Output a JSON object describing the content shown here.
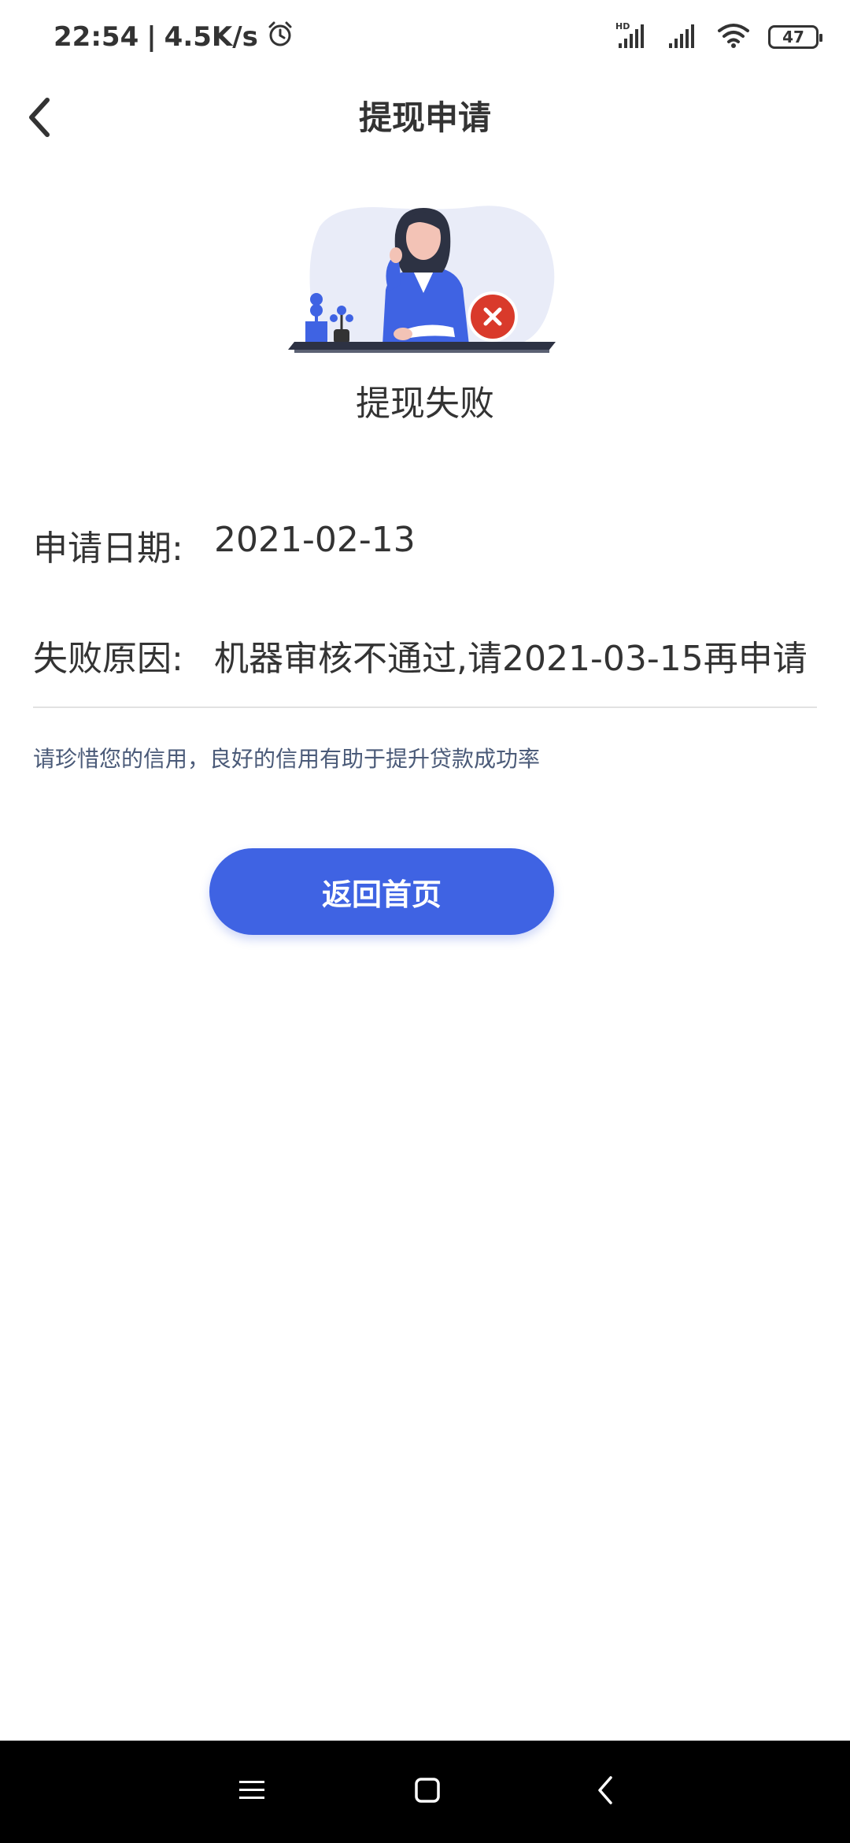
{
  "status_bar": {
    "time": "22:54",
    "separator": "|",
    "net_speed": "4.5K/s",
    "battery_level": "47",
    "icons": [
      "alarm-icon",
      "hd-signal-icon",
      "signal-icon",
      "wifi-icon",
      "battery-icon"
    ]
  },
  "header": {
    "title": "提现申请",
    "back_icon": "chevron-left-icon"
  },
  "result": {
    "illustration_icon": "woman-at-desk-illustration",
    "status_icon": "close-circle-icon",
    "title": "提现失败"
  },
  "info": {
    "date_label": "申请日期:",
    "date_value": "2021-02-13",
    "reason_label": "失败原因:",
    "reason_value": "机器审核不通过,请2021-03-15再申请"
  },
  "tip": "请珍惜您的信用，良好的信用有助于提升贷款成功率",
  "button": {
    "home_label": "返回首页"
  },
  "nav_bar": {
    "icons": [
      "menu-icon",
      "home-square-icon",
      "back-icon"
    ]
  },
  "colors": {
    "accent": "#3f63e3",
    "error": "#d93a2b",
    "tip_text": "#4a5a78",
    "text": "#333333"
  }
}
